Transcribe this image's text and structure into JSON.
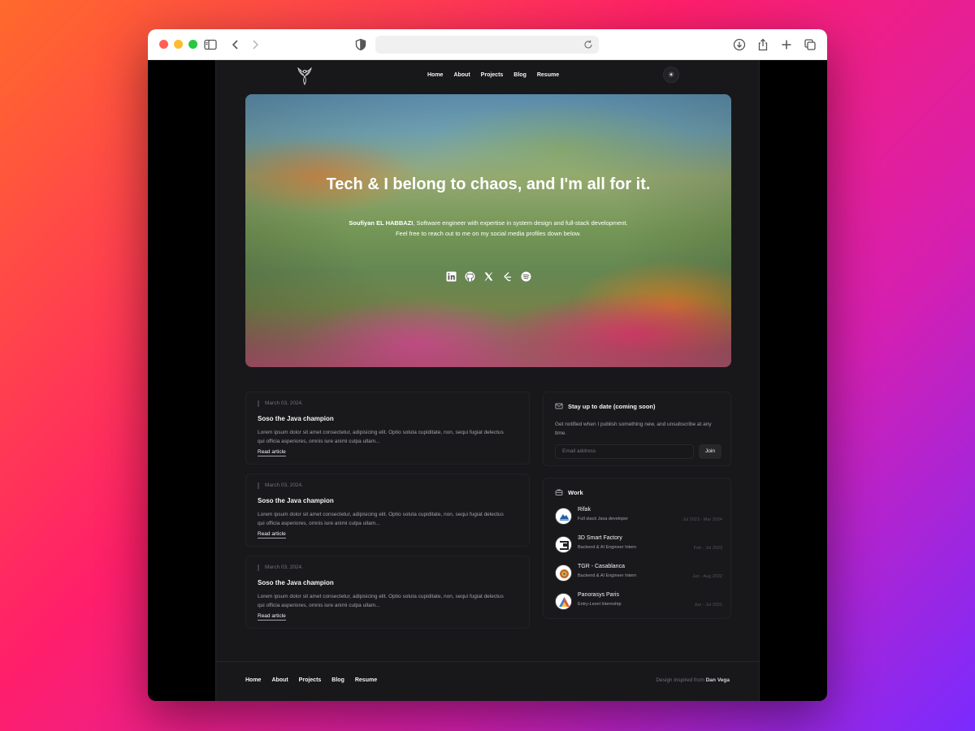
{
  "nav": {
    "links": [
      "Home",
      "About",
      "Projects",
      "Blog",
      "Resume"
    ]
  },
  "hero": {
    "title": "Tech & I belong to chaos, and I'm all for it.",
    "name": "Soufiyan EL HABBAZI",
    "bio": ", Software engineer with expertise in system design and full-stack development.",
    "bio_line2": "Feel free to reach out to me on my social media profiles down below.",
    "socials": [
      "linkedin-icon",
      "github-icon",
      "x-icon",
      "leetcode-icon",
      "spotify-icon"
    ]
  },
  "articles": [
    {
      "date": "March 03, 2024.",
      "title": "Soso the Java champion",
      "excerpt": "Lorem ipsum dolor sit amet consectetur, adipisicing elit. Optio soluta cupiditate, non, sequi fugiat delectus qui officia asperiores, omnis iure animi culpa ullam...",
      "link": "Read article"
    },
    {
      "date": "March 03, 2024.",
      "title": "Soso the Java champion",
      "excerpt": "Lorem ipsum dolor sit amet consectetur, adipisicing elit. Optio soluta cupiditate, non, sequi fugiat delectus qui officia asperiores, omnis iure animi culpa ullam...",
      "link": "Read article"
    },
    {
      "date": "March 03, 2024.",
      "title": "Soso the Java champion",
      "excerpt": "Lorem ipsum dolor sit amet consectetur, adipisicing elit. Optio soluta cupiditate, non, sequi fugiat delectus qui officia asperiores, omnis iure animi culpa ullam...",
      "link": "Read article"
    }
  ],
  "newsletter": {
    "title": "Stay up to date (coming soon)",
    "description": "Get notified when I publish something new, and unsubscribe at any time.",
    "placeholder": "Email address",
    "button": "Join"
  },
  "work": {
    "title": "Work",
    "jobs": [
      {
        "company": "Rifak",
        "role": "Full stack Java developer",
        "dates": "Jul 2023 - Mar 2024"
      },
      {
        "company": "3D Smart Factory",
        "role": "Backend & AI Engineer Intern",
        "dates": "Feb - Jul 2023"
      },
      {
        "company": "TGR - Casablanca",
        "role": "Backend & AI Engineer Intern",
        "dates": "Jun - Aug 2022"
      },
      {
        "company": "Panorasys Paris",
        "role": "Entry-Level Internship",
        "dates": "Jun - Jul 2021"
      }
    ]
  },
  "footer": {
    "links": [
      "Home",
      "About",
      "Projects",
      "Blog",
      "Resume"
    ],
    "credit_prefix": "Design inspired from ",
    "credit_name": "Dan Vega"
  },
  "colors": {
    "page_bg": "#18181b",
    "card_bg": "#19191c",
    "text": "#f4f4f5",
    "muted": "#a1a1aa"
  }
}
